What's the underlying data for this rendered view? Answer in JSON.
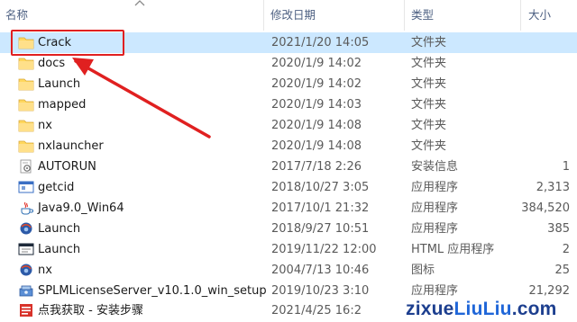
{
  "header": {
    "columns": [
      {
        "label": "名称"
      },
      {
        "label": "修改日期"
      },
      {
        "label": "类型"
      },
      {
        "label": "大小"
      }
    ]
  },
  "files": [
    {
      "name": "Crack",
      "date": "2021/1/20 14:05",
      "type": "文件夹",
      "size": "",
      "icon": "folder-icon",
      "selected": true
    },
    {
      "name": "docs",
      "date": "2020/1/9 14:02",
      "type": "文件夹",
      "size": "",
      "icon": "folder-icon"
    },
    {
      "name": "Launch",
      "date": "2020/1/9 14:02",
      "type": "文件夹",
      "size": "",
      "icon": "folder-icon"
    },
    {
      "name": "mapped",
      "date": "2020/1/9 14:03",
      "type": "文件夹",
      "size": "",
      "icon": "folder-icon"
    },
    {
      "name": "nx",
      "date": "2020/1/9 14:08",
      "type": "文件夹",
      "size": "",
      "icon": "folder-icon"
    },
    {
      "name": "nxlauncher",
      "date": "2020/1/9 14:08",
      "type": "文件夹",
      "size": "",
      "icon": "folder-icon"
    },
    {
      "name": "AUTORUN",
      "date": "2017/7/18 2:26",
      "type": "安装信息",
      "size": "1",
      "icon": "setup-info-icon"
    },
    {
      "name": "getcid",
      "date": "2018/10/27 3:05",
      "type": "应用程序",
      "size": "2,313",
      "icon": "app-window-icon"
    },
    {
      "name": "Java9.0_Win64",
      "date": "2017/10/1 21:32",
      "type": "应用程序",
      "size": "384,520",
      "icon": "java-icon"
    },
    {
      "name": "Launch",
      "date": "2018/9/27 10:51",
      "type": "应用程序",
      "size": "385",
      "icon": "nx-app-icon"
    },
    {
      "name": "Launch",
      "date": "2019/11/22 12:00",
      "type": "HTML 应用程序",
      "size": "2",
      "icon": "hta-icon"
    },
    {
      "name": "nx",
      "date": "2004/7/13 10:46",
      "type": "图标",
      "size": "25",
      "icon": "nx-app-icon"
    },
    {
      "name": "SPLMLicenseServer_v10.1.0_win_setup",
      "date": "2019/10/23 3:10",
      "type": "应用程序",
      "size": "21,292",
      "icon": "installer-icon"
    },
    {
      "name": "点我获取 - 安装步骤",
      "date": "2021/4/25 16:2",
      "type": "",
      "size": "",
      "icon": "doc-icon"
    }
  ],
  "watermark": {
    "part_a": "zixue",
    "part_b": "LiuLiu",
    "part_c": ".com"
  },
  "colors": {
    "selected_row": "#cce8ff",
    "highlight": "#e02020",
    "folder": "#ffd75e"
  }
}
